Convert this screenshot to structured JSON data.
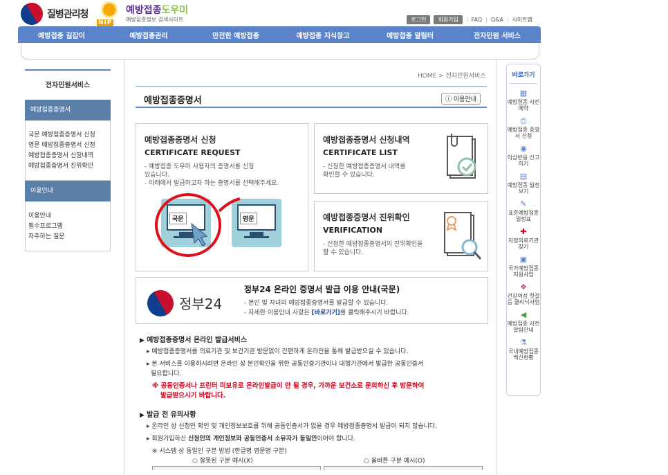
{
  "header": {
    "kdca_name": "질병관리청",
    "nip_badge": "NIP",
    "nip_title_a": "예방접종",
    "nip_title_b": "도우미",
    "nip_sub": "예방접종정보 검색사이트",
    "top_links": [
      "로그인",
      "회원가입",
      "FAQ",
      "Q&A",
      "사이트맵"
    ]
  },
  "gnb": [
    "예방접종 길잡이",
    "예방접종관리",
    "안전한 예방접종",
    "예방접종 지식창고",
    "예방접종 알림터",
    "전자민원 서비스"
  ],
  "sidebar": {
    "title": "전자민원서비스",
    "cat1": "예방접종증명서",
    "cat1_items": [
      "국문 예방접종증명서 신청",
      "영문 예방접종증명서 신청",
      "예방접종증명서 신청내역",
      "예방접종증명서 진위확인"
    ],
    "cat2": "이용안내",
    "cat2_items": [
      "이용안내",
      "필수프로그램",
      "자주하는 질문"
    ]
  },
  "breadcrumb": "HOME > 전자민원서비스",
  "page_title": "예방접종증명서",
  "guide_btn": "이용안내",
  "box1": {
    "ko": "예방접종증명서 신청",
    "en": "CERTIFICATE REQUEST",
    "d1": "- 예방접종 도우미 사용자의 증명서를 신청",
    "d2": "  있습니다.",
    "d3": "- 아래에서 발급하고자 하는 증명서를 선택해주세요.",
    "kor": "국문",
    "eng": "영문"
  },
  "box2": {
    "ko": "예방접종증명서 신청내역",
    "en": "CERTIFICATE LIST",
    "d1": "- 신청한 예방접종증명서 내역를",
    "d2": "  확인할 수 있습니다."
  },
  "box3": {
    "ko": "예방접종증명서 진위확인",
    "en": "VERIFICATION",
    "d1": "- 신청한 예방접종증명서의 진위확인을",
    "d2": "  할 수 있습니다."
  },
  "gov24": {
    "logo": "정부24",
    "title": "정부24 온라인 증명서 발급 이용 안내(국문)",
    "l1": "- 본인 및 자녀의 예방접종증명서를 발급할 수 있습니다.",
    "l2a": "- 자세한 이용안내 사항은 ",
    "l2b": "[바로가기]",
    "l2c": "를 클릭해주시기 바랍니다."
  },
  "online": {
    "title": "예방접종증명서 온라인 발급서비스",
    "l1": "예방접종증명서를 의료기관 및 보건기관 방문없이 간편하게 온라인을 통해 발급받으실 수 있습니다.",
    "l2a": "본 서비스를 이용하시려면 온라인 상 본인확인을 위한 공동인증기관이나 대행기관에서 발급한 공동인증서",
    "l2b": "필요합니다.",
    "warn1": "※ 공동인증서나 프린터 미보유로 온라인발급이 안 될 경우, 가까운 보건소로 문의하신 후 방문하여",
    "warn2": "발급받으시기 바랍니다."
  },
  "notice": {
    "title": "발급 전 유의사항",
    "l1": "온라인 상 신청인 확인 및 개인정보보호를 위해 공동인증서가 없을 경우 예방접종증명서 발급이 되지 않습니다.",
    "l2a": "회원가입하신 ",
    "l2b": "신청인의 개인정보와 공동인증서 소유자가 동일인",
    "l2c": "이어야 합니다.",
    "l3": "※ 시스템 상 동일인 구분 방법 (한글명 영문명 구분)",
    "bad": "○ 잘못된 구분 예시(X)",
    "good": "○ 올바른 구분 예시(O)"
  },
  "quick": {
    "title": "바로가기",
    "items": [
      {
        "icon": "calendar-icon",
        "label": "예방접종 사전예약"
      },
      {
        "icon": "printer-icon",
        "label": "예방접종 증명서 신청"
      },
      {
        "icon": "report-icon",
        "label": "이상반응 신고하기"
      },
      {
        "icon": "schedule-icon",
        "label": "예방접종 일정보기"
      },
      {
        "icon": "syringe-icon",
        "label": "표준예방접종 일정표"
      },
      {
        "icon": "hospital-icon",
        "label": "지정의료기관 찾기"
      },
      {
        "icon": "document-icon",
        "label": "국가예방접종 지원사업"
      },
      {
        "icon": "clinic-icon",
        "label": "건강여성 첫걸음 클리닉사업"
      },
      {
        "icon": "speaker-icon",
        "label": "예방접종 사전알림안내"
      },
      {
        "icon": "vaccine-icon",
        "label": "국내예방접종 백신현황"
      }
    ]
  }
}
